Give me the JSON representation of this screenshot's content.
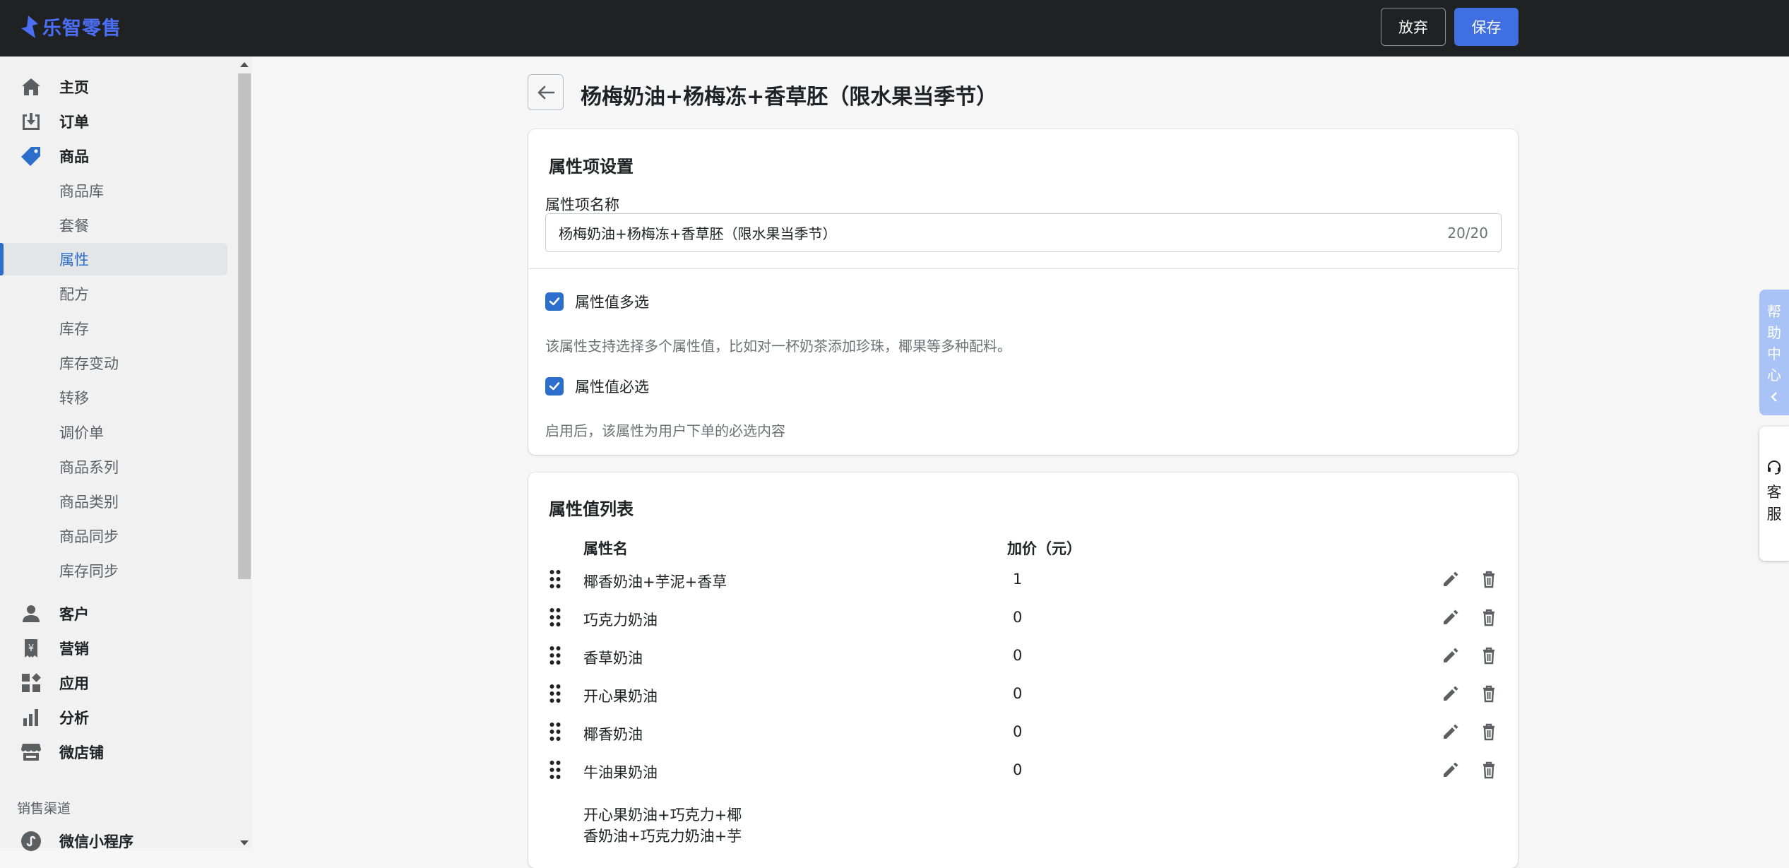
{
  "header": {
    "app_name": "乐智零售",
    "discard_label": "放弃",
    "save_label": "保存"
  },
  "sidebar": {
    "main_items": [
      {
        "label": "主页",
        "icon": "home-icon"
      },
      {
        "label": "订单",
        "icon": "orders-icon"
      },
      {
        "label": "商品",
        "icon": "tag-icon"
      }
    ],
    "sub_items": [
      {
        "label": "商品库"
      },
      {
        "label": "套餐"
      },
      {
        "label": "属性",
        "active": true
      },
      {
        "label": "配方"
      },
      {
        "label": "库存"
      },
      {
        "label": "库存变动"
      },
      {
        "label": "转移"
      },
      {
        "label": "调价单"
      },
      {
        "label": "商品系列"
      },
      {
        "label": "商品类别"
      },
      {
        "label": "商品同步"
      },
      {
        "label": "库存同步"
      }
    ],
    "more_items": [
      {
        "label": "客户",
        "icon": "person-icon"
      },
      {
        "label": "营销",
        "icon": "marketing-icon"
      },
      {
        "label": "应用",
        "icon": "apps-icon"
      },
      {
        "label": "分析",
        "icon": "analytics-icon"
      },
      {
        "label": "微店铺",
        "icon": "store-icon"
      }
    ],
    "section_title": "销售渠道",
    "channel_items": [
      {
        "label": "微信小程序",
        "icon": "miniprogram-icon"
      }
    ]
  },
  "page": {
    "title": "杨梅奶油+杨梅冻+香草胚（限水果当季节）"
  },
  "settings_card": {
    "title": "属性项设置",
    "name_label": "属性项名称",
    "name_value": "杨梅奶油+杨梅冻+香草胚（限水果当季节）",
    "name_counter": "20/20",
    "multi_select_label": "属性值多选",
    "multi_select_checked": true,
    "multi_select_help": "该属性支持选择多个属性值，比如对一杯奶茶添加珍珠，椰果等多种配料。",
    "required_label": "属性值必选",
    "required_checked": true,
    "required_help": "启用后，该属性为用户下单的必选内容"
  },
  "values_card": {
    "title": "属性值列表",
    "col_name": "属性名",
    "col_price": "加价（元）",
    "rows": [
      {
        "name": "椰香奶油+芋泥+香草",
        "price": "1"
      },
      {
        "name": "巧克力奶油",
        "price": "0"
      },
      {
        "name": "香草奶油",
        "price": "0"
      },
      {
        "name": "开心果奶油",
        "price": "0"
      },
      {
        "name": "椰香奶油",
        "price": "0"
      },
      {
        "name": "牛油果奶油",
        "price": "0"
      }
    ],
    "partial_row_name": "开心果奶油+巧克力+椰香奶油+巧克力奶油+芋"
  },
  "floating": {
    "help_chars": [
      "帮",
      "助",
      "中",
      "心"
    ],
    "cs_chars": [
      "客",
      "服"
    ]
  },
  "colors": {
    "accent": "#2c6ecb",
    "save_button": "#3f6fe0",
    "topbar": "#202123",
    "help_tab": "#a9c3f7"
  }
}
